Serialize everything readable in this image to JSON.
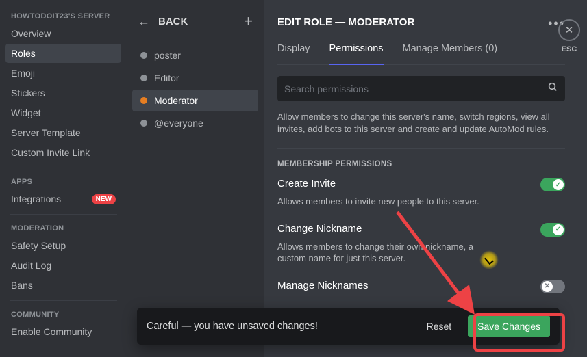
{
  "sidebar1": {
    "header": "HOWTODOIT23'S SERVER",
    "items": [
      "Overview",
      "Roles",
      "Emoji",
      "Stickers",
      "Widget",
      "Server Template",
      "Custom Invite Link"
    ],
    "active_index": 1,
    "section_apps": "APPS",
    "apps_items": [
      "Integrations"
    ],
    "apps_badge": "NEW",
    "section_moderation": "MODERATION",
    "moderation_items": [
      "Safety Setup",
      "Audit Log",
      "Bans"
    ],
    "section_community": "COMMUNITY",
    "community_items": [
      "Enable Community"
    ]
  },
  "roles": {
    "back": "BACK",
    "list": [
      {
        "name": "poster",
        "color": "gray"
      },
      {
        "name": "Editor",
        "color": "gray"
      },
      {
        "name": "Moderator",
        "color": "orange"
      },
      {
        "name": "@everyone",
        "color": "gray"
      }
    ],
    "active_index": 2
  },
  "editor": {
    "title": "EDIT ROLE — MODERATOR",
    "tabs": [
      "Display",
      "Permissions",
      "Manage Members (0)"
    ],
    "active_tab": 1,
    "search_placeholder": "Search permissions",
    "intro_hint": "Allow members to change this server's name, switch regions, view all invites, add bots to this server and create and update AutoMod rules.",
    "section_title": "MEMBERSHIP PERMISSIONS",
    "perms": [
      {
        "name": "Create Invite",
        "desc": "Allows members to invite new people to this server.",
        "on": true
      },
      {
        "name": "Change Nickname",
        "desc": "Allows members to change their own nickname, a custom name for just this server.",
        "on": true
      },
      {
        "name": "Manage Nicknames",
        "desc": "",
        "on": false
      }
    ]
  },
  "close": {
    "esc": "ESC"
  },
  "toast": {
    "msg": "Careful — you have unsaved changes!",
    "reset": "Reset",
    "save": "Save Changes"
  }
}
